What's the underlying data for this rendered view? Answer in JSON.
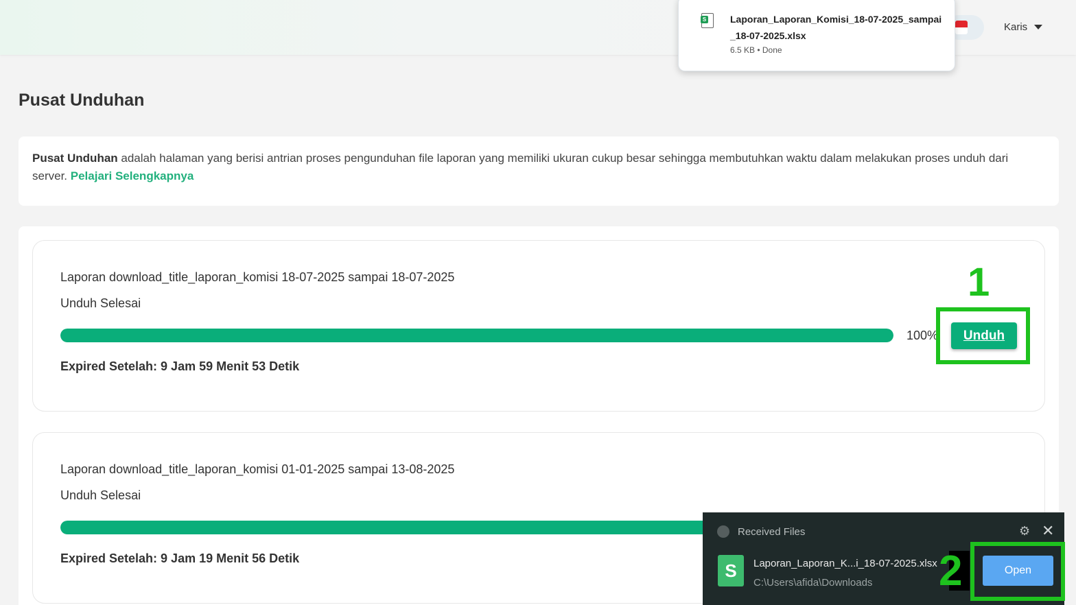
{
  "header": {
    "user_name": "Karis"
  },
  "download_popup": {
    "file_name": "Laporan_Laporan_Komisi_18-07-2025_sampai_18-07-2025.xlsx",
    "meta": "6.5 KB • Done",
    "file_icon_letter": "S"
  },
  "page": {
    "title": "Pusat Unduhan",
    "info_bold": "Pusat Unduhan",
    "info_text": " adalah halaman yang berisi antrian proses pengunduhan file laporan yang memiliki ukuran cukup besar sehingga membutuhkan waktu dalam melakukan proses unduh dari server. ",
    "info_link": "Pelajari Selengkapnya"
  },
  "downloads": [
    {
      "title": "Laporan download_title_laporan_komisi 18-07-2025 sampai 18-07-2025",
      "status": "Unduh Selesai",
      "progress": 100,
      "progress_label": "100%",
      "expired": "Expired Setelah: 9 Jam 59 Menit 53 Detik",
      "button_label": "Unduh"
    },
    {
      "title": "Laporan download_title_laporan_komisi 01-01-2025 sampai 13-08-2025",
      "status": "Unduh Selesai",
      "progress": 100,
      "expired": "Expired Setelah: 9 Jam 19 Menit 56 Detik"
    }
  ],
  "annotations": {
    "step1": "1",
    "step2": "2"
  },
  "received_files": {
    "title": "Received Files",
    "file_name": "Laporan_Laporan_K...i_18-07-2025.xlsx",
    "file_path": "C:\\Users\\afida\\Downloads",
    "open_label": "Open"
  },
  "colors": {
    "accent": "#0aae7a",
    "link": "#22b07d",
    "highlight": "#1ec21e",
    "open_button": "#5aa7f2"
  }
}
